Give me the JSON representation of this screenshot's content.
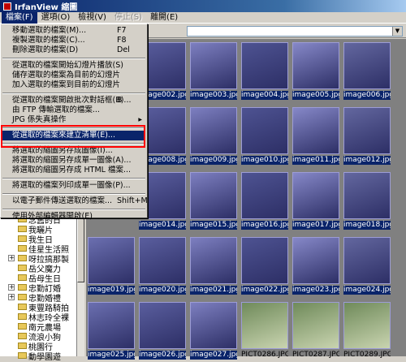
{
  "window": {
    "title": "IrfanView 縮圖"
  },
  "menubar": [
    {
      "label": "檔案(F)",
      "state": "active"
    },
    {
      "label": "選項(O)",
      "state": "normal"
    },
    {
      "label": "檢視(V)",
      "state": "normal"
    },
    {
      "label": "停止(S)",
      "state": "disabled"
    },
    {
      "label": "離開(E)",
      "state": "normal"
    }
  ],
  "file_menu": [
    {
      "label": "移動選取的檔案(M)...",
      "shortcut": "F7"
    },
    {
      "label": "複製選取的檔案(C)...",
      "shortcut": "F8"
    },
    {
      "label": "刪除選取的檔案(D)",
      "shortcut": "Del"
    },
    {
      "sep": true
    },
    {
      "label": "從選取的檔案開始幻燈片播放(S)",
      "shortcut": ""
    },
    {
      "label": "儲存選取的檔案為目前的幻燈片",
      "shortcut": ""
    },
    {
      "label": "加入選取的檔案到目前的幻燈片",
      "shortcut": ""
    },
    {
      "sep": true
    },
    {
      "label": "從選取的檔案開啟批次對話框(B)...",
      "shortcut": "B"
    },
    {
      "label": "由 FTP 傳輸選取的檔案...",
      "shortcut": ""
    },
    {
      "label": "JPG 係失真操作",
      "shortcut": "",
      "submenu": true
    },
    {
      "sep": true
    },
    {
      "label": "從選取的檔案來建立清單(E)...",
      "shortcut": "",
      "highlighted": true
    },
    {
      "sep": true
    },
    {
      "label": "將選取的縮圖另存成圖像(I)...",
      "shortcut": ""
    },
    {
      "label": "將選取的縮圖另存成單一圖像(A)...",
      "shortcut": ""
    },
    {
      "label": "將選取的縮圖另存成 HTML 檔案...",
      "shortcut": ""
    },
    {
      "sep": true
    },
    {
      "label": "將選取的檔案列印成單一圖像(P)...",
      "shortcut": ""
    },
    {
      "sep": true
    },
    {
      "label": "以電子郵件傳送選取的檔案...",
      "shortcut": "Shift+M"
    },
    {
      "sep": true
    },
    {
      "label": "使用外部編輯器開啟(E)",
      "shortcut": ""
    }
  ],
  "tree": [
    {
      "label": "念舊的日",
      "plus": false
    },
    {
      "label": "我曬片",
      "plus": false
    },
    {
      "label": "我生日",
      "plus": false
    },
    {
      "label": "佳星生活照",
      "plus": false
    },
    {
      "label": "呀拉搞那製",
      "plus": true
    },
    {
      "label": "岳父魔力",
      "plus": false
    },
    {
      "label": "岳母生日",
      "plus": false
    },
    {
      "label": "忠勤訂婚",
      "plus": true
    },
    {
      "label": "忠勤婚禮",
      "plus": true
    },
    {
      "label": "東豐路騎拍",
      "plus": false
    },
    {
      "label": "林志玲全裸",
      "plus": false
    },
    {
      "label": "南元農場",
      "plus": false
    },
    {
      "label": "流浪小狗",
      "plus": false
    },
    {
      "label": "桃園行",
      "plus": false
    },
    {
      "label": "動學園遊",
      "plus": false
    }
  ],
  "thumbnails": [
    {
      "label": "",
      "selected": false
    },
    {
      "label": "image002.jpg",
      "selected": true
    },
    {
      "label": "image003.jpg",
      "selected": true
    },
    {
      "label": "image004.jpg",
      "selected": true
    },
    {
      "label": "image005.jpg",
      "selected": true
    },
    {
      "label": "image006.jpg",
      "selected": true
    },
    {
      "label": "",
      "selected": false
    },
    {
      "label": "image008.jpg",
      "selected": true
    },
    {
      "label": "image009.jpg",
      "selected": true
    },
    {
      "label": "image010.jpg",
      "selected": true
    },
    {
      "label": "image011.jpg",
      "selected": true
    },
    {
      "label": "image012.jpg",
      "selected": true
    },
    {
      "label": "",
      "selected": false
    },
    {
      "label": "image014.jpg",
      "selected": true
    },
    {
      "label": "image015.jpg",
      "selected": true
    },
    {
      "label": "image016.jpg",
      "selected": true
    },
    {
      "label": "image017.jpg",
      "selected": true
    },
    {
      "label": "image018.jpg",
      "selected": true
    },
    {
      "label": "image019.jpg",
      "selected": true
    },
    {
      "label": "image020.jpg",
      "selected": true
    },
    {
      "label": "image021.jpg",
      "selected": true
    },
    {
      "label": "image022.jpg",
      "selected": true
    },
    {
      "label": "image023.jpg",
      "selected": true
    },
    {
      "label": "image024.jpg",
      "selected": true
    },
    {
      "label": "image025.jpg",
      "selected": true
    },
    {
      "label": "image026.jpg",
      "selected": true
    },
    {
      "label": "image027.jpg",
      "selected": true
    },
    {
      "label": "PICT0286.JPG",
      "selected": false
    },
    {
      "label": "PICT0287.JPG",
      "selected": false
    },
    {
      "label": "PICT0289.JPG",
      "selected": false
    }
  ]
}
